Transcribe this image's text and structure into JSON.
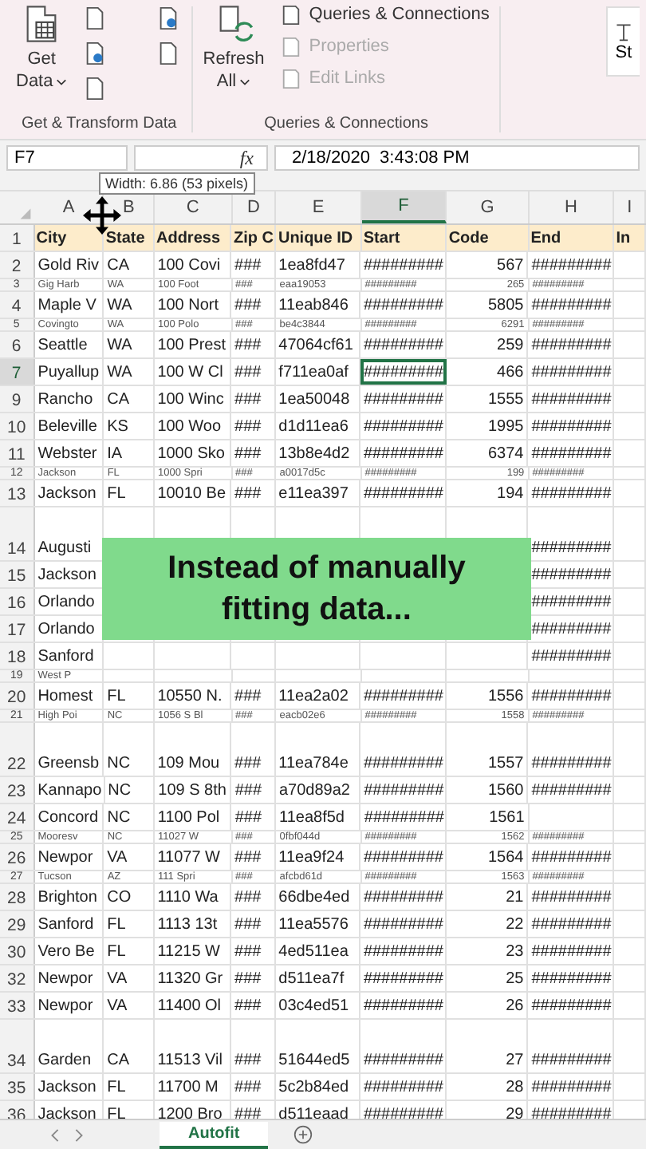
{
  "ribbon": {
    "groups": [
      {
        "big_button": {
          "lines": [
            "Get",
            "Data"
          ],
          "dropdown": true
        },
        "label": "Get & Transform Data"
      },
      {
        "big_button": {
          "lines": [
            "Refresh",
            "All"
          ],
          "dropdown": true
        },
        "items": [
          {
            "label": "Queries & Connections",
            "disabled": false
          },
          {
            "label": "Properties",
            "disabled": true
          },
          {
            "label": "Edit Links",
            "disabled": true
          }
        ],
        "label": "Queries & Connections"
      }
    ],
    "partial_button": "St"
  },
  "formula_bar": {
    "name_box": "F7",
    "function_symbol": "fx",
    "value": "2/18/2020  3:43:08 PM"
  },
  "tooltip": "Width: 6.86 (53 pixels)",
  "table": {
    "columns": [
      {
        "letter": "A",
        "selected": false
      },
      {
        "letter": "B",
        "selected": false
      },
      {
        "letter": "C",
        "selected": false
      },
      {
        "letter": "D",
        "selected": false
      },
      {
        "letter": "E",
        "selected": false
      },
      {
        "letter": "F",
        "selected": true
      },
      {
        "letter": "G",
        "selected": false
      },
      {
        "letter": "H",
        "selected": false
      },
      {
        "letter": "I",
        "selected": false
      }
    ],
    "rows": [
      {
        "num": "1",
        "kind": "header",
        "selected": false,
        "cells": {
          "A": "City",
          "B": "State",
          "C": "Address",
          "D": "Zip C",
          "E": "Unique ID",
          "F": "Start",
          "G": "Code",
          "H": "End",
          "I": "In"
        }
      },
      {
        "num": "2",
        "kind": "normal",
        "selected": false,
        "cells": {
          "A": "Gold Riv",
          "B": "CA",
          "C": "100 Covi",
          "D": "###",
          "E": "1ea8fd47",
          "F": "#########",
          "G": "567",
          "H": "#########"
        }
      },
      {
        "num": "3",
        "kind": "short",
        "selected": false,
        "cells": {
          "A": "Gig Harb",
          "B": "WA",
          "C": "100 Foot",
          "D": "###",
          "E": "eaa19053",
          "F": "#########",
          "G": "265",
          "H": "#########"
        }
      },
      {
        "num": "4",
        "kind": "normal",
        "selected": false,
        "cells": {
          "A": "Maple V",
          "B": "WA",
          "C": "100 Nort",
          "D": "###",
          "E": "11eab846",
          "F": "#########",
          "G": "5805",
          "H": "#########"
        }
      },
      {
        "num": "5",
        "kind": "short",
        "selected": false,
        "cells": {
          "A": "Covingto",
          "B": "WA",
          "C": "100 Polo",
          "D": "###",
          "E": "be4c3844",
          "F": "#########",
          "G": "6291",
          "H": "#########"
        }
      },
      {
        "num": "6",
        "kind": "normal",
        "selected": false,
        "cells": {
          "A": "Seattle",
          "B": "WA",
          "C": "100 Prest",
          "D": "###",
          "E": "47064cf61",
          "F": "#########",
          "G": "259",
          "H": "#########"
        }
      },
      {
        "num": "7",
        "kind": "normal",
        "selected": true,
        "cells": {
          "A": "Puyallup",
          "B": "WA",
          "C": "100 W Cl",
          "D": "###",
          "E": "f711ea0af",
          "F": "#########",
          "G": "466",
          "H": "#########"
        }
      },
      {
        "num": "9",
        "kind": "normal",
        "selected": false,
        "cells": {
          "A": "Rancho",
          "B": "CA",
          "C": "100 Winc",
          "D": "###",
          "E": "1ea50048",
          "F": "#########",
          "G": "1555",
          "H": "#########"
        }
      },
      {
        "num": "10",
        "kind": "normal",
        "selected": false,
        "cells": {
          "A": "Beleville",
          "B": "KS",
          "C": "100 Woo",
          "D": "###",
          "E": "d1d11ea6",
          "F": "#########",
          "G": "1995",
          "H": "#########"
        }
      },
      {
        "num": "11",
        "kind": "normal",
        "selected": false,
        "cells": {
          "A": "Webster",
          "B": "IA",
          "C": "1000 Sko",
          "D": "###",
          "E": "13b8e4d2",
          "F": "#########",
          "G": "6374",
          "H": "#########"
        }
      },
      {
        "num": "12",
        "kind": "short",
        "selected": false,
        "cells": {
          "A": "Jackson",
          "B": "FL",
          "C": "1000 Spri",
          "D": "###",
          "E": "a0017d5c",
          "F": "#########",
          "G": "199",
          "H": "#########"
        }
      },
      {
        "num": "13",
        "kind": "normal",
        "selected": false,
        "cells": {
          "A": "Jackson",
          "B": "FL",
          "C": "10010 Be",
          "D": "###",
          "E": "e11ea397",
          "F": "#########",
          "G": "194",
          "H": "#########"
        }
      },
      {
        "num": "14",
        "kind": "tall",
        "selected": false,
        "cells": {
          "A": "Augusti",
          "H": "#########"
        }
      },
      {
        "num": "15",
        "kind": "normal",
        "selected": false,
        "cells": {
          "A": "Jackson",
          "H": "#########"
        }
      },
      {
        "num": "16",
        "kind": "normal",
        "selected": false,
        "cells": {
          "A": "Orlando",
          "H": "#########"
        }
      },
      {
        "num": "17",
        "kind": "normal",
        "selected": false,
        "cells": {
          "A": "Orlando",
          "H": "#########"
        }
      },
      {
        "num": "18",
        "kind": "normal",
        "selected": false,
        "cells": {
          "A": "Sanford",
          "H": "#########"
        }
      },
      {
        "num": "19",
        "kind": "short",
        "selected": false,
        "cells": {
          "A": "West P"
        }
      },
      {
        "num": "20",
        "kind": "normal",
        "selected": false,
        "cells": {
          "A": "Homest",
          "B": "FL",
          "C": "10550 N.",
          "D": "###",
          "E": "11ea2a02",
          "F": "#########",
          "G": "1556",
          "H": "#########"
        }
      },
      {
        "num": "21",
        "kind": "short",
        "selected": false,
        "cells": {
          "A": "High Poi",
          "B": "NC",
          "C": "1056 S Bl",
          "D": "###",
          "E": "eacb02e6",
          "F": "#########",
          "G": "1558",
          "H": "#########"
        }
      },
      {
        "num": "22",
        "kind": "tall",
        "selected": false,
        "cells": {
          "A": "Greensb",
          "B": "NC",
          "C": "109 Mou",
          "D": "###",
          "E": "11ea784e",
          "F": "#########",
          "G": "1557",
          "H": "#########"
        }
      },
      {
        "num": "23",
        "kind": "normal",
        "selected": false,
        "cells": {
          "A": "Kannapo",
          "B": "NC",
          "C": "109 S 8th",
          "D": "###",
          "E": "a70d89a2",
          "F": "#########",
          "G": "1560",
          "H": "#########"
        }
      },
      {
        "num": "24",
        "kind": "normal",
        "selected": false,
        "cells": {
          "A": "Concord",
          "B": "NC",
          "C": "1100 Pol",
          "D": "###",
          "E": "11ea8f5d",
          "F": "#########",
          "G": "1561"
        }
      },
      {
        "num": "25",
        "kind": "short",
        "selected": false,
        "cells": {
          "A": "Mooresv",
          "B": "NC",
          "C": "11027 W",
          "D": "###",
          "E": "0fbf044d",
          "F": "#########",
          "G": "1562",
          "H": "#########"
        }
      },
      {
        "num": "26",
        "kind": "normal",
        "selected": false,
        "cells": {
          "A": "Newpor",
          "B": "VA",
          "C": "11077 W",
          "D": "###",
          "E": "11ea9f24",
          "F": "#########",
          "G": "1564",
          "H": "#########"
        }
      },
      {
        "num": "27",
        "kind": "short",
        "selected": false,
        "cells": {
          "A": "Tucson",
          "B": "AZ",
          "C": "111 Spri",
          "D": "###",
          "E": "afcbd61d",
          "F": "#########",
          "G": "1563",
          "H": "#########"
        }
      },
      {
        "num": "28",
        "kind": "normal",
        "selected": false,
        "cells": {
          "A": "Brighton",
          "B": "CO",
          "C": "1110 Wa",
          "D": "###",
          "E": "66dbe4ed",
          "F": "#########",
          "G": "21",
          "H": "#########"
        }
      },
      {
        "num": "29",
        "kind": "normal",
        "selected": false,
        "cells": {
          "A": "Sanford",
          "B": "FL",
          "C": "1113 13t",
          "D": "###",
          "E": "11ea5576",
          "F": "#########",
          "G": "22",
          "H": "#########"
        }
      },
      {
        "num": "30",
        "kind": "normal",
        "selected": false,
        "cells": {
          "A": "Vero Be",
          "B": "FL",
          "C": "11215 W",
          "D": "###",
          "E": "4ed511ea",
          "F": "#########",
          "G": "23",
          "H": "#########"
        }
      },
      {
        "num": "32",
        "kind": "normal",
        "selected": false,
        "cells": {
          "A": "Newpor",
          "B": "VA",
          "C": "11320 Gr",
          "D": "###",
          "E": "d511ea7f",
          "F": "#########",
          "G": "25",
          "H": "#########"
        }
      },
      {
        "num": "33",
        "kind": "normal",
        "selected": false,
        "cells": {
          "A": "Newpor",
          "B": "VA",
          "C": "11400 Ol",
          "D": "###",
          "E": "03c4ed51",
          "F": "#########",
          "G": "26",
          "H": "#########"
        }
      },
      {
        "num": "34",
        "kind": "tall",
        "selected": false,
        "cells": {
          "A": "Garden",
          "B": "CA",
          "C": "11513 Vil",
          "D": "###",
          "E": "51644ed5",
          "F": "#########",
          "G": "27",
          "H": "#########"
        }
      },
      {
        "num": "35",
        "kind": "normal",
        "selected": false,
        "cells": {
          "A": "Jackson",
          "B": "FL",
          "C": "11700 M",
          "D": "###",
          "E": "5c2b84ed",
          "F": "#########",
          "G": "28",
          "H": "#########"
        }
      },
      {
        "num": "36",
        "kind": "normal",
        "selected": false,
        "cells": {
          "A": "Jackson",
          "B": "FL",
          "C": "1200 Bro",
          "D": "###",
          "E": "d511eaad",
          "F": "#########",
          "G": "29",
          "H": "#########"
        }
      }
    ]
  },
  "caption": "Instead of manually fitting data...",
  "sheet_tabs": [
    {
      "label": "Autofit",
      "selected": true
    }
  ]
}
